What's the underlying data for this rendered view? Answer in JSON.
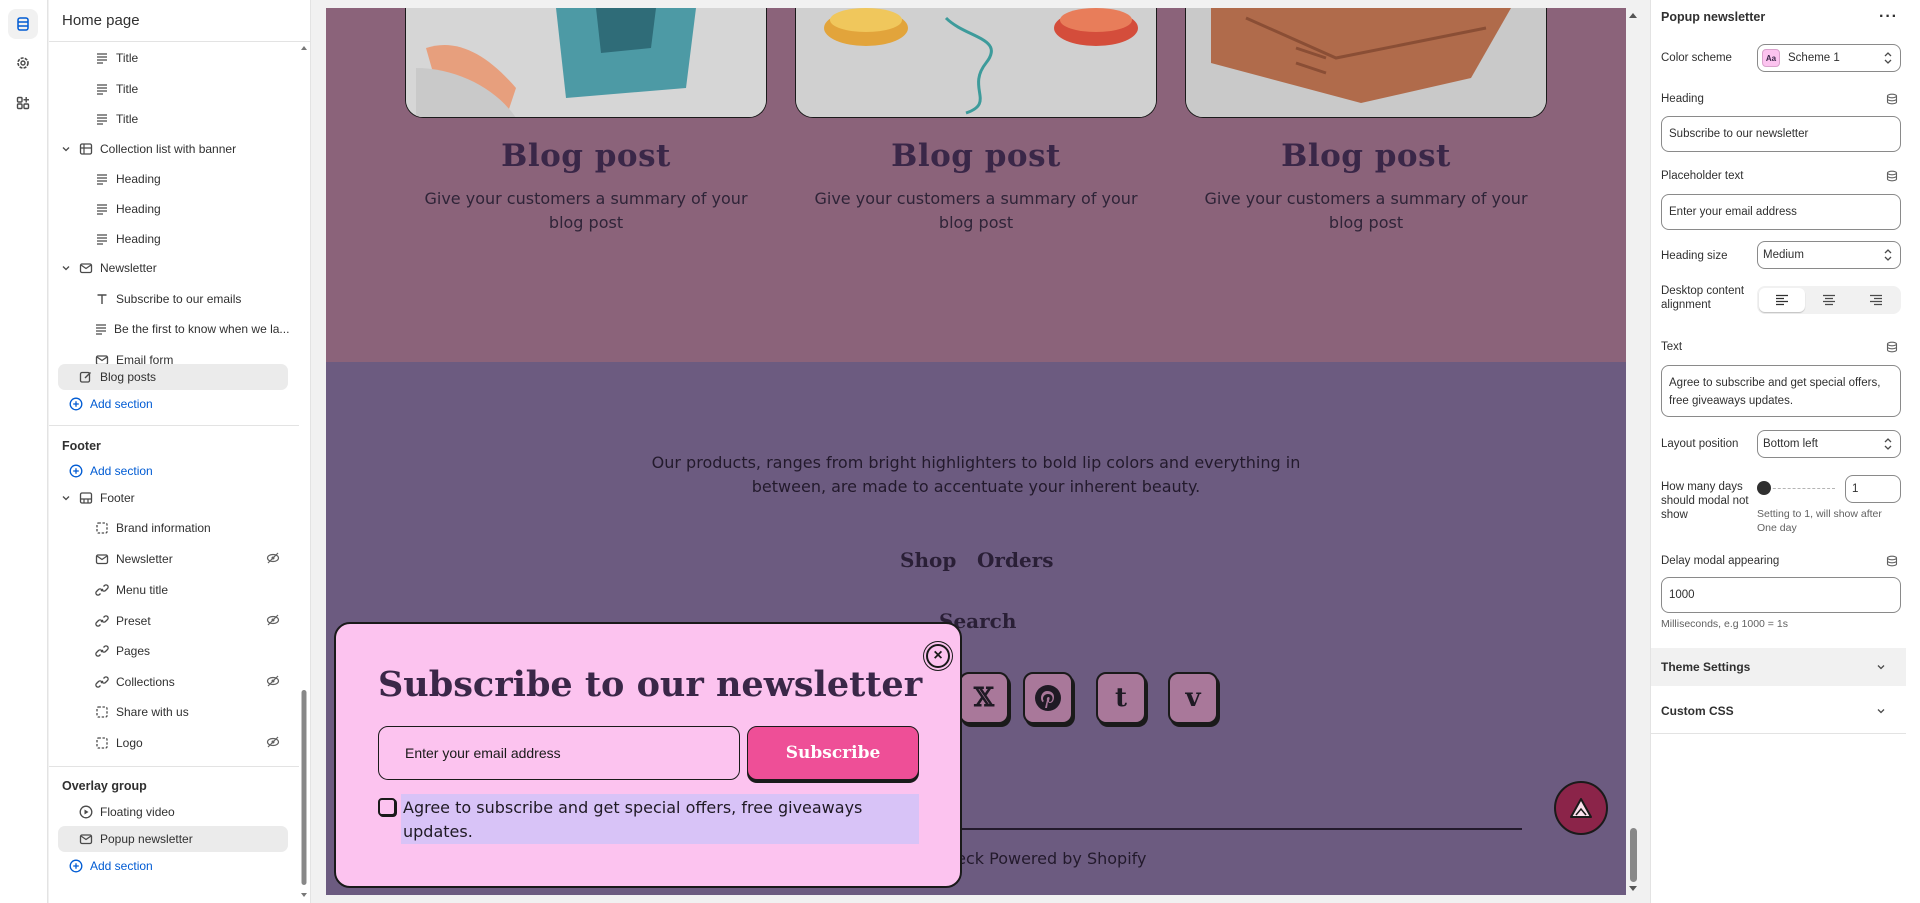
{
  "sidebar": {
    "title": "Home page",
    "tree": [
      {
        "label": "Title",
        "icon": "text-lines-icon"
      },
      {
        "label": "Title",
        "icon": "text-lines-icon"
      },
      {
        "label": "Title",
        "icon": "text-lines-icon"
      },
      {
        "label": "Collection list with banner",
        "icon": "collection-list-icon"
      },
      {
        "label": "Heading",
        "icon": "text-lines-icon"
      },
      {
        "label": "Heading",
        "icon": "text-lines-icon"
      },
      {
        "label": "Heading",
        "icon": "text-lines-icon"
      },
      {
        "label": "Newsletter",
        "icon": "envelope-icon"
      },
      {
        "label": "Subscribe to our emails",
        "icon": "text-t-icon"
      },
      {
        "label": "Be the first to know when we la...",
        "icon": "text-lines-icon"
      },
      {
        "label": "Email form",
        "icon": "envelope-icon"
      },
      {
        "label": "Blog posts",
        "icon": "edit-icon"
      },
      {
        "label": "Add section",
        "icon": "plus-circle-icon"
      }
    ],
    "footer_group": {
      "title": "Footer",
      "add_label": "Add section",
      "section_label": "Footer",
      "blocks": [
        {
          "label": "Brand information",
          "icon": "dashed-square-icon",
          "hidden": false
        },
        {
          "label": "Newsletter",
          "icon": "envelope-icon",
          "hidden": true
        },
        {
          "label": "Menu title",
          "icon": "link-icon",
          "hidden": false
        },
        {
          "label": "Preset",
          "icon": "link-icon",
          "hidden": true
        },
        {
          "label": "Pages",
          "icon": "link-icon",
          "hidden": false
        },
        {
          "label": "Collections",
          "icon": "link-icon",
          "hidden": true
        },
        {
          "label": "Share with us",
          "icon": "dashed-square-icon",
          "hidden": false
        },
        {
          "label": "Logo",
          "icon": "dashed-square-icon",
          "hidden": true
        }
      ]
    },
    "overlay_group": {
      "title": "Overlay group",
      "items": [
        {
          "label": "Floating video",
          "icon": "play-circle-icon"
        },
        {
          "label": "Popup newsletter",
          "icon": "envelope-icon"
        }
      ],
      "add_label": "Add section"
    }
  },
  "preview": {
    "blog_cards": [
      {
        "title": "Blog post",
        "summary": "Give your customers a summary of your blog post"
      },
      {
        "title": "Blog post",
        "summary": "Give your customers a summary of your blog post"
      },
      {
        "title": "Blog post",
        "summary": "Give your customers a summary of your blog post"
      }
    ],
    "footer_text": "Our products, ranges from bright highlighters to bold lip colors and everything in between, are made to accentuate your inherent beauty.",
    "footer_menu": [
      "Shop",
      "Orders",
      "Search"
    ],
    "social_icons": [
      "x-icon",
      "pinterest-icon",
      "tumblr-icon",
      "vimeo-icon"
    ],
    "powered": "heck Powered by Shopify",
    "popup": {
      "heading": "Subscribe to our newsletter",
      "placeholder": "Enter your email address",
      "button": "Subscribe",
      "agree": "Agree to subscribe and get special offers, free giveaways updates."
    },
    "colors": {
      "top_bg": "#8b637a",
      "bottom_bg": "#6c5b80",
      "popup_bg": "#fcc3ef",
      "button_bg": "#ee4f97",
      "to_top_bg": "#8b2449"
    }
  },
  "panel": {
    "title": "Popup newsletter",
    "color_scheme_label": "Color scheme",
    "color_scheme_value": "Scheme 1",
    "color_scheme_swatch": "Aa",
    "heading_label": "Heading",
    "heading_value": "Subscribe to our newsletter",
    "placeholder_label": "Placeholder text",
    "placeholder_value": "Enter your email address",
    "heading_size_label": "Heading size",
    "heading_size_value": "Medium",
    "alignment_label": "Desktop content alignment",
    "alignment_selected": "left",
    "text_label": "Text",
    "text_value": "Agree to subscribe and get special offers, free giveaways updates.",
    "layout_position_label": "Layout position",
    "layout_position_value": "Bottom left",
    "days_label": "How many days should modal not show",
    "days_value": "1",
    "days_help": "Setting to 1, will show after One day",
    "delay_label": "Delay modal appearing",
    "delay_value": "1000",
    "delay_help": "Milliseconds, e.g 1000 = 1s",
    "theme_settings": "Theme Settings",
    "custom_css": "Custom CSS"
  }
}
